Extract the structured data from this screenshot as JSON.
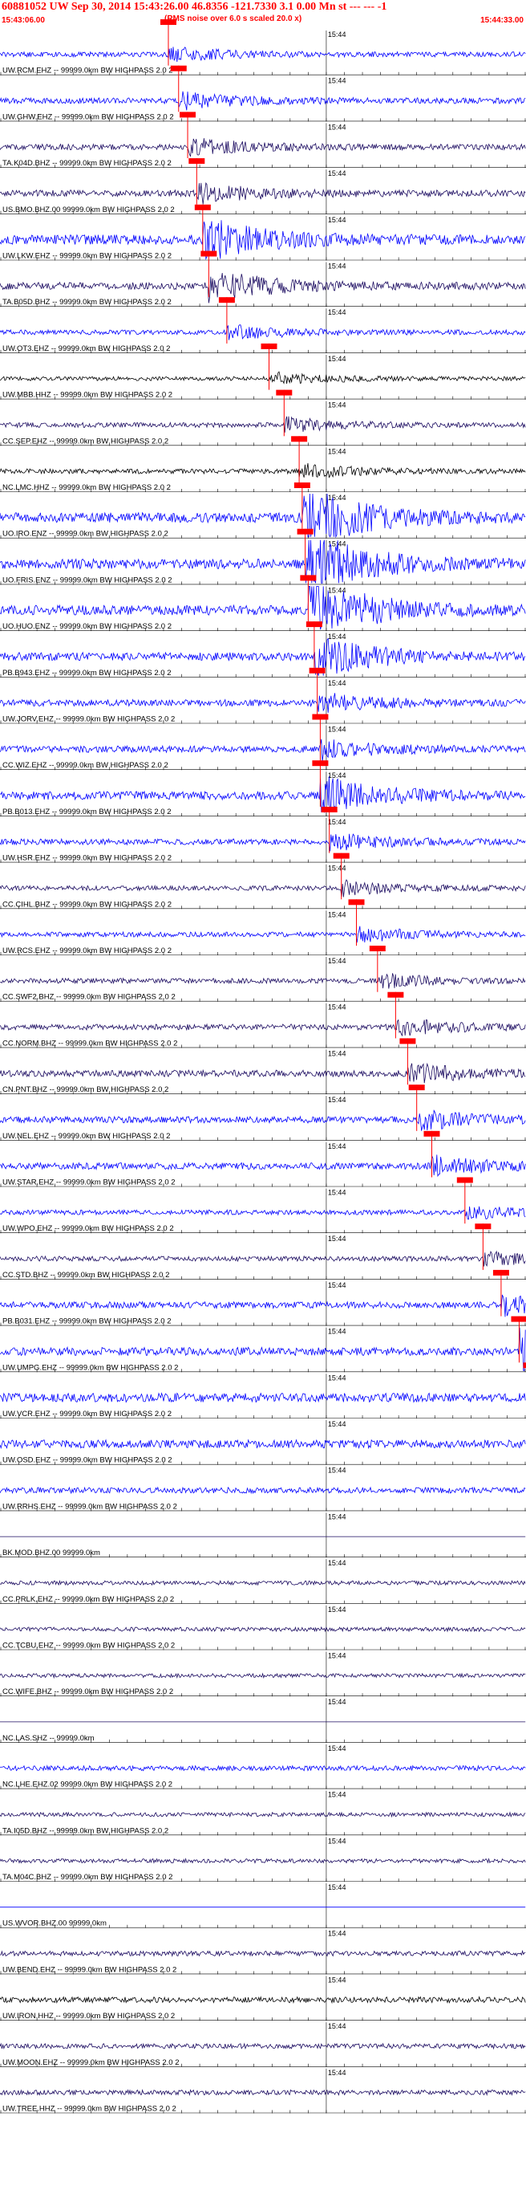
{
  "header": {
    "title": "60881052 UW Sep 30, 2014 15:43:26.00   46.8356 -121.7330  3.1 0.00 Mn st --- --- -1",
    "subtitle": "(RMS noise over 6.0 s scaled 20.0 x)",
    "start_time": "15:43:06.00",
    "end_time": "15:44:33.00"
  },
  "chart_data": {
    "type": "line",
    "title": "60881052 UW Sep 30, 2014 15:43:26.00   46.8356 -121.7330  3.1 0.00 Mn st --- --- -1",
    "subtitle": "(RMS noise over 6.0 s scaled 20.0 x)",
    "xlim": [
      "15:43:06.00",
      "15:44:33.00"
    ],
    "tick_label": "15:44",
    "grid": true,
    "colors": {
      "blue": "#0000ff",
      "black": "#000000",
      "navy": "#1a0a60",
      "red": "#ff0000"
    },
    "series": [
      {
        "label": "UW.RCM.EHZ -- 99999.0km BW HIGHPASS  2.0  2",
        "color": "blue",
        "amp": 0.3,
        "pick_s": 27.8
      },
      {
        "label": "UW.GHW.EHZ -- 99999.0km BW HIGHPASS  2.0  2",
        "color": "blue",
        "amp": 0.35,
        "pick_s": 29.5
      },
      {
        "label": "TA.K04D.BHZ -- 99999.0km BW HIGHPASS  2.0  2",
        "color": "navy",
        "amp": 0.35,
        "pick_s": 31.0
      },
      {
        "label": "US.BMO.BHZ.00 99999.0km BW HIGHPASS  2.0  2",
        "color": "navy",
        "amp": 0.4,
        "pick_s": 32.5
      },
      {
        "label": "UW.LKW.EHZ -- 99999.0km BW HIGHPASS  2.0  2",
        "color": "blue",
        "amp": 0.6,
        "pick_s": 33.5,
        "burst": 1.5
      },
      {
        "label": "TA.B05D.BHZ -- 99999.0km BW HIGHPASS  2.0  2",
        "color": "navy",
        "amp": 0.45,
        "pick_s": 34.5,
        "burst": 1.6
      },
      {
        "label": "UW.OT3.EHZ -- 99999.0km BW HIGHPASS  2.0  2",
        "color": "blue",
        "amp": 0.3,
        "pick_s": 37.5
      },
      {
        "label": "UW.MBB.HHZ -- 99999.0km BW HIGHPASS  2.0  2",
        "color": "black",
        "amp": 0.25,
        "pick_s": 44.5
      },
      {
        "label": "CC.SEP.EHZ -- 99999.0km BW HIGHPASS  2.0  2",
        "color": "navy",
        "amp": 0.3,
        "pick_s": 47.0
      },
      {
        "label": "NC.LMC.HHZ -- 99999.0km BW HIGHPASS  2.0  2",
        "color": "black",
        "amp": 0.3,
        "pick_s": 49.5
      },
      {
        "label": "UO.IRO.ENZ -- 99999.0km BW HIGHPASS  2.0  2",
        "color": "blue",
        "amp": 0.6,
        "pick_s": 50.0,
        "burst": 2.5
      },
      {
        "label": "UO.FRIS.ENZ -- 99999.0km BW HIGHPASS  2.0  2",
        "color": "blue",
        "amp": 0.6,
        "pick_s": 50.5,
        "burst": 2.5
      },
      {
        "label": "UO.HUO.ENZ -- 99999.0km BW HIGHPASS  2.0  2",
        "color": "blue",
        "amp": 0.6,
        "pick_s": 51.0,
        "burst": 2.5
      },
      {
        "label": "PB.B943.EHZ -- 99999.0km BW HIGHPASS  2.0  2",
        "color": "blue",
        "amp": 0.5,
        "pick_s": 52.0,
        "burst": 1.8
      },
      {
        "label": "UW.JORV.EHZ -- 99999.0km BW HIGHPASS  2.0  2",
        "color": "blue",
        "amp": 0.4,
        "pick_s": 52.5
      },
      {
        "label": "CC.WIZ.EHZ -- 99999.0km BW HIGHPASS  2.0  2",
        "color": "blue",
        "amp": 0.4,
        "pick_s": 53.0
      },
      {
        "label": "PB.B013.EHZ -- 99999.0km BW HIGHPASS  2.0  2",
        "color": "blue",
        "amp": 0.5,
        "pick_s": 53.0,
        "burst": 1.6
      },
      {
        "label": "UW.HSR.EHZ -- 99999.0km BW HIGHPASS  2.0  2",
        "color": "blue",
        "amp": 0.35,
        "pick_s": 54.5
      },
      {
        "label": "CC.CIHL.BHZ -- 99999.0km BW HIGHPASS  2.0  2",
        "color": "navy",
        "amp": 0.3,
        "pick_s": 56.5
      },
      {
        "label": "UW.RCS.EHZ -- 99999.0km BW HIGHPASS  2.0  2",
        "color": "blue",
        "amp": 0.3,
        "pick_s": 59.0
      },
      {
        "label": "CC.SWF2.BHZ -- 99999.0km BW HIGHPASS  2.0  2",
        "color": "navy",
        "amp": 0.3,
        "pick_s": 62.5
      },
      {
        "label": "CC.NORM.BHZ -- 99999.0km BW HIGHPASS  2.0  2",
        "color": "navy",
        "amp": 0.35,
        "pick_s": 65.5
      },
      {
        "label": "CN.PNT.BHZ -- 99999.0km BW HIGHPASS  2.0  2",
        "color": "navy",
        "amp": 0.4,
        "pick_s": 67.5
      },
      {
        "label": "UW.NEL.EHZ -- 99999.0km BW HIGHPASS  2.0  2",
        "color": "blue",
        "amp": 0.4,
        "pick_s": 69.0
      },
      {
        "label": "UW.STAR.EHZ -- 99999.0km BW HIGHPASS  2.0  2",
        "color": "blue",
        "amp": 0.4,
        "pick_s": 71.5
      },
      {
        "label": "UW.WPO.EHZ -- 99999.0km BW HIGHPASS  2.0  2",
        "color": "blue",
        "amp": 0.3,
        "pick_s": 77.0
      },
      {
        "label": "CC.STD.BHZ -- 99999.0km BW HIGHPASS  2.0  2",
        "color": "navy",
        "amp": 0.3,
        "pick_s": 80.0
      },
      {
        "label": "PB.B031.EHZ -- 99999.0km BW HIGHPASS  2.0  2",
        "color": "blue",
        "amp": 0.4,
        "pick_s": 83.0
      },
      {
        "label": "UW.UMPG.EHZ -- 99999.0km BW HIGHPASS  2.0  2",
        "color": "blue",
        "amp": 0.5,
        "pick_s": 86.0,
        "burst": 2.2
      },
      {
        "label": "UW.VCR.EHZ -- 99999.0km BW HIGHPASS  2.0  2",
        "color": "blue",
        "amp": 0.55,
        "pick_s": 88.0,
        "burst": 1.8
      },
      {
        "label": "UW.OSD.EHZ -- 99999.0km BW HIGHPASS  2.0  2",
        "color": "blue",
        "amp": 0.5,
        "pick_s": 90.5,
        "burst": 2.0
      },
      {
        "label": "UW.RRHS.EHZ -- 99999.0km BW HIGHPASS  2.0  2",
        "color": "blue",
        "amp": 0.35,
        "pick_s": null
      },
      {
        "label": "BK.MOD.BHZ.00 99999.0km",
        "color": "navy",
        "amp": 0.0,
        "pick_s": null
      },
      {
        "label": "CC.PRLK.EHZ -- 99999.0km BW HIGHPASS  2.0  2",
        "color": "navy",
        "amp": 0.25,
        "pick_s": null
      },
      {
        "label": "CC.TCBU.EHZ -- 99999.0km BW HIGHPASS  2.0  2",
        "color": "navy",
        "amp": 0.25,
        "pick_s": null
      },
      {
        "label": "CC.WIFE.BHZ -- 99999.0km BW HIGHPASS  2.0  2",
        "color": "navy",
        "amp": 0.25,
        "pick_s": null
      },
      {
        "label": "NC.LAS.SHZ -- 99999.0km",
        "color": "navy",
        "amp": 0.0,
        "pick_s": null
      },
      {
        "label": "NC.LHE.EHZ.02 99999.0km BW HIGHPASS  2.0  2",
        "color": "blue",
        "amp": 0.3,
        "pick_s": null
      },
      {
        "label": "TA.I05D.BHZ -- 99999.0km BW HIGHPASS  2.0  2",
        "color": "navy",
        "amp": 0.25,
        "pick_s": null
      },
      {
        "label": "TA.M04C.BHZ -- 99999.0km BW HIGHPASS  2.0  2",
        "color": "navy",
        "amp": 0.25,
        "pick_s": null
      },
      {
        "label": "US.WVOR.BHZ.00 99999.0km",
        "color": "blue",
        "amp": 0.0,
        "pick_s": null
      },
      {
        "label": "UW.BEND.EHZ -- 99999.0km BW HIGHPASS  2.0  2",
        "color": "navy",
        "amp": 0.3,
        "pick_s": null
      },
      {
        "label": "UW.IRON.HHZ -- 99999.0km BW HIGHPASS  2.0  2",
        "color": "black",
        "amp": 0.35,
        "pick_s": null
      },
      {
        "label": "UW.MOON.EHZ -- 99999.0km BW HIGHPASS  2.0  2",
        "color": "navy",
        "amp": 0.3,
        "pick_s": null
      },
      {
        "label": "UW.TREE.HHZ -- 99999.0km BW HIGHPASS  2.0  2",
        "color": "navy",
        "amp": 0.3,
        "pick_s": null
      }
    ]
  }
}
